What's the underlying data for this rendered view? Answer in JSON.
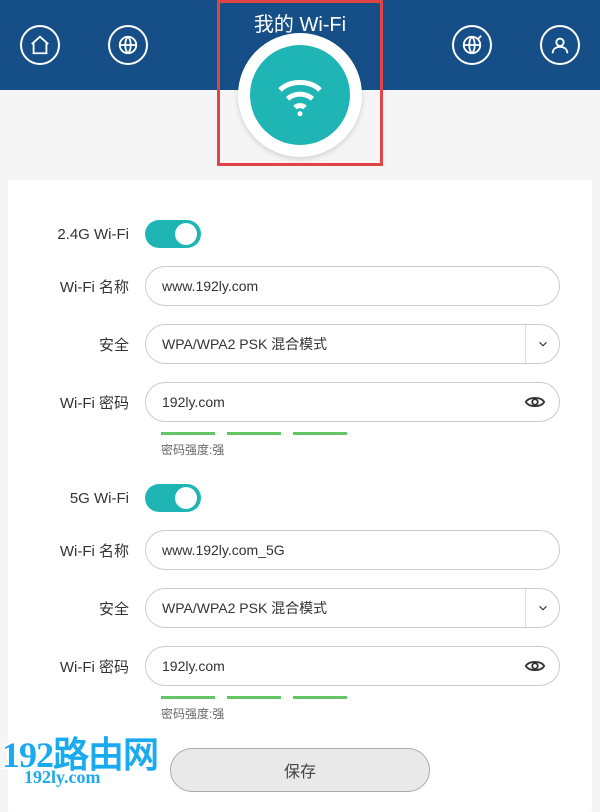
{
  "header": {
    "title": "我的 Wi-Fi"
  },
  "sections": {
    "g24": {
      "toggle_label": "2.4G Wi-Fi",
      "name_label": "Wi-Fi 名称",
      "name_value": "www.192ly.com",
      "security_label": "安全",
      "security_value": "WPA/WPA2 PSK 混合模式",
      "password_label": "Wi-Fi 密码",
      "password_value": "192ly.com",
      "strength_text": "密码强度:强"
    },
    "g5": {
      "toggle_label": "5G Wi-Fi",
      "name_label": "Wi-Fi 名称",
      "name_value": "www.192ly.com_5G",
      "security_label": "安全",
      "security_value": "WPA/WPA2 PSK 混合模式",
      "password_label": "Wi-Fi 密码",
      "password_value": "192ly.com",
      "strength_text": "密码强度:强"
    }
  },
  "buttons": {
    "save": "保存"
  },
  "watermark": {
    "line1": "192路由网",
    "line2": "192ly.com"
  }
}
